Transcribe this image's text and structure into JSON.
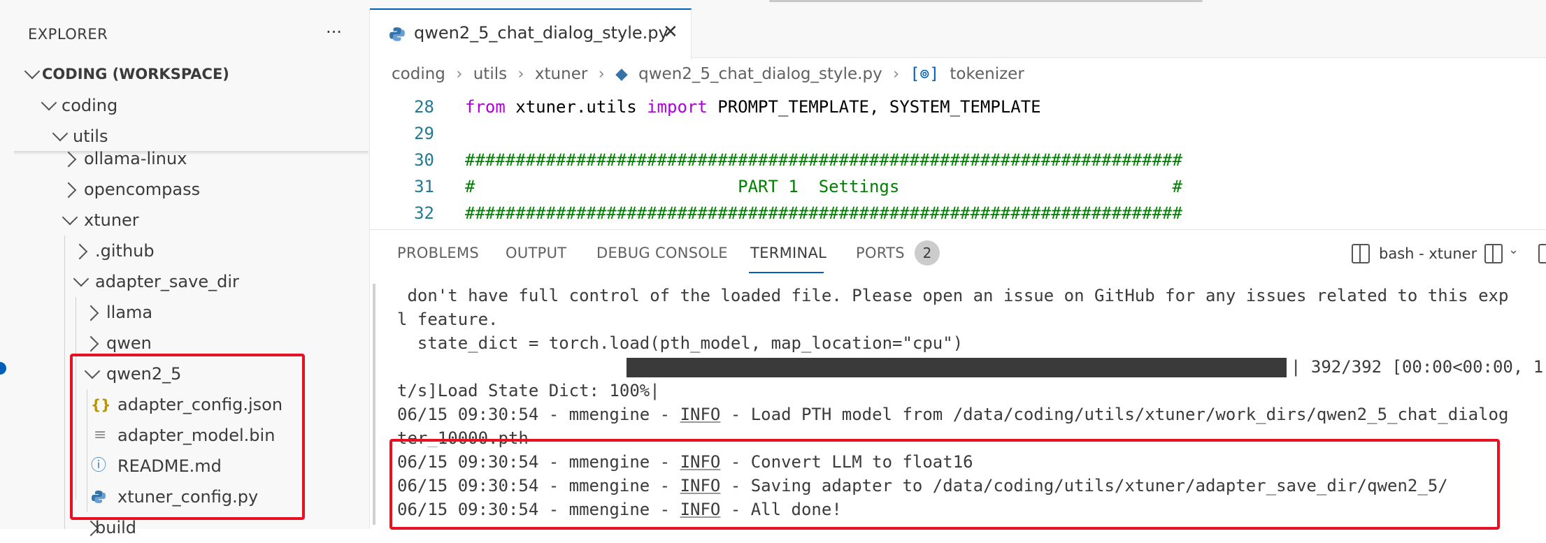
{
  "sidebar": {
    "title": "EXPLORER",
    "more_icon": "more-actions-icon",
    "workspace": "CODING (WORKSPACE)",
    "tree": [
      {
        "label": "coding",
        "icon": "chevron-down-icon"
      },
      {
        "label": "utils",
        "icon": "chevron-down-icon"
      },
      {
        "label": "ollama-linux",
        "icon": "chevron-right-icon"
      },
      {
        "label": "opencompass",
        "icon": "chevron-right-icon"
      },
      {
        "label": "xtuner",
        "icon": "chevron-down-icon"
      },
      {
        "label": ".github",
        "icon": "chevron-right-icon"
      },
      {
        "label": "adapter_save_dir",
        "icon": "chevron-down-icon"
      },
      {
        "label": "llama",
        "icon": "chevron-right-icon"
      },
      {
        "label": "qwen",
        "icon": "chevron-right-icon"
      },
      {
        "label": "qwen2_5",
        "icon": "chevron-down-icon"
      },
      {
        "label": "adapter_config.json",
        "icon": "json-file-icon"
      },
      {
        "label": "adapter_model.bin",
        "icon": "text-file-icon"
      },
      {
        "label": "README.md",
        "icon": "info-file-icon"
      },
      {
        "label": "xtuner_config.py",
        "icon": "python-file-icon"
      },
      {
        "label": "build",
        "icon": "chevron-right-icon"
      }
    ]
  },
  "editor": {
    "tab_label": "qwen2_5_chat_dialog_style.py",
    "breadcrumbs": [
      "coding",
      "utils",
      "xtuner",
      "qwen2_5_chat_dialog_style.py",
      "tokenizer"
    ],
    "lines": [
      {
        "num": "28",
        "parts": [
          {
            "t": "from",
            "c": "kw"
          },
          {
            "t": " xtuner.utils ",
            "c": ""
          },
          {
            "t": "import",
            "c": "kw"
          },
          {
            "t": " PROMPT_TEMPLATE, SYSTEM_TEMPLATE",
            "c": ""
          }
        ]
      },
      {
        "num": "29",
        "parts": []
      },
      {
        "num": "30",
        "parts": [
          {
            "t": "#######################################################################",
            "c": "cm"
          }
        ]
      },
      {
        "num": "31",
        "parts": [
          {
            "t": "#                          PART 1  Settings                           #",
            "c": "cm"
          }
        ]
      },
      {
        "num": "32",
        "parts": [
          {
            "t": "#######################################################################",
            "c": "cm"
          }
        ]
      }
    ]
  },
  "panel": {
    "tabs": [
      "PROBLEMS",
      "OUTPUT",
      "DEBUG CONSOLE",
      "TERMINAL",
      "PORTS"
    ],
    "ports_count": "2",
    "terminal_name": "bash - xtuner"
  },
  "terminal": {
    "lines": [
      " don't have full control of the loaded file. Please open an issue on GitHub for any issues related to this exp",
      "l feature.",
      "  state_dict = torch.load(pth_model, map_location=\"cpu\")",
      "Load State Dict: 100%|",
      "t/s]",
      "06/15 09:30:54 - mmengine - INFO - Load PTH model from /data/coding/utils/xtuner/work_dirs/qwen2_5_chat_dialog",
      "ter_10000.pth",
      "06/15 09:30:54 - mmengine - INFO - Convert LLM to float16",
      "06/15 09:30:54 - mmengine - INFO - Saving adapter to /data/coding/utils/xtuner/adapter_save_dir/qwen2_5/",
      "06/15 09:30:54 - mmengine - INFO - All done!"
    ],
    "progress_suffix": "| 392/392 [00:00<00:00, 1",
    "progress_fraction": 1.0
  }
}
